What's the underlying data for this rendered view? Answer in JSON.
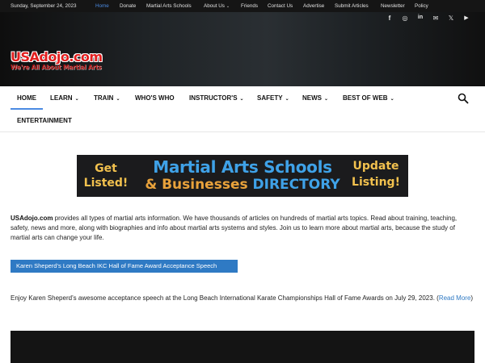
{
  "topbar": {
    "date": "Sunday, September 24, 2023",
    "links": [
      "Home",
      "Donate",
      "Martial Arts Schools",
      "About Us",
      "Friends",
      "Contact Us",
      "Advertise",
      "Submit Articles",
      "Newsletter",
      "Policy"
    ],
    "about_chevron": "⌄"
  },
  "header": {
    "social": [
      "f",
      "◎",
      "in",
      "✉",
      "𝕏",
      "▶"
    ],
    "social_names": [
      "facebook",
      "instagram",
      "linkedin",
      "mail",
      "x-twitter",
      "youtube"
    ],
    "logo_main": "USAdojo.com",
    "logo_tag": "We're All About Martial Arts"
  },
  "nav": {
    "items": [
      "HOME",
      "LEARN",
      "TRAIN",
      "WHO'S WHO",
      "INSTRUCTOR'S",
      "SAFETY",
      "NEWS",
      "BEST OF WEB",
      "ENTERTAINMENT"
    ],
    "chevron": "⌄",
    "accent": "#4b8be3"
  },
  "banner": {
    "left": "Get Listed!",
    "left_l1": "Get",
    "left_l2": "Listed!",
    "title_line1": "Martial Arts Schools",
    "title_amp": "& Businesses",
    "title_dir": "DIRECTORY",
    "right_l1": "Update",
    "right_l2": "Listing!"
  },
  "intro": {
    "site": "USAdojo.com",
    "text": " provides all types of martial arts information. We have thousands of articles on hundreds of martial arts topics. Read about training, teaching, safety, news and more, along with biographies and info about martial arts systems and styles. Join us to learn more about martial arts, because the study of martial arts can change your life."
  },
  "video_button": "Karen Sheperd’s Long Beach IKC Hall of Fame Award Acceptance Speech",
  "enjoy": {
    "text": "Enjoy Karen Sheperd’s awesome acceptance speech at the Long Beach International Karate Championships Hall of Fame Awards on July 29, 2023. (",
    "link": "Read More",
    "close": ")"
  },
  "colors": {
    "link_blue": "#2f7ac4",
    "logo_red": "#e31f1f",
    "banner_gold": "#f2c14e",
    "banner_blue": "#3fa2e8"
  }
}
